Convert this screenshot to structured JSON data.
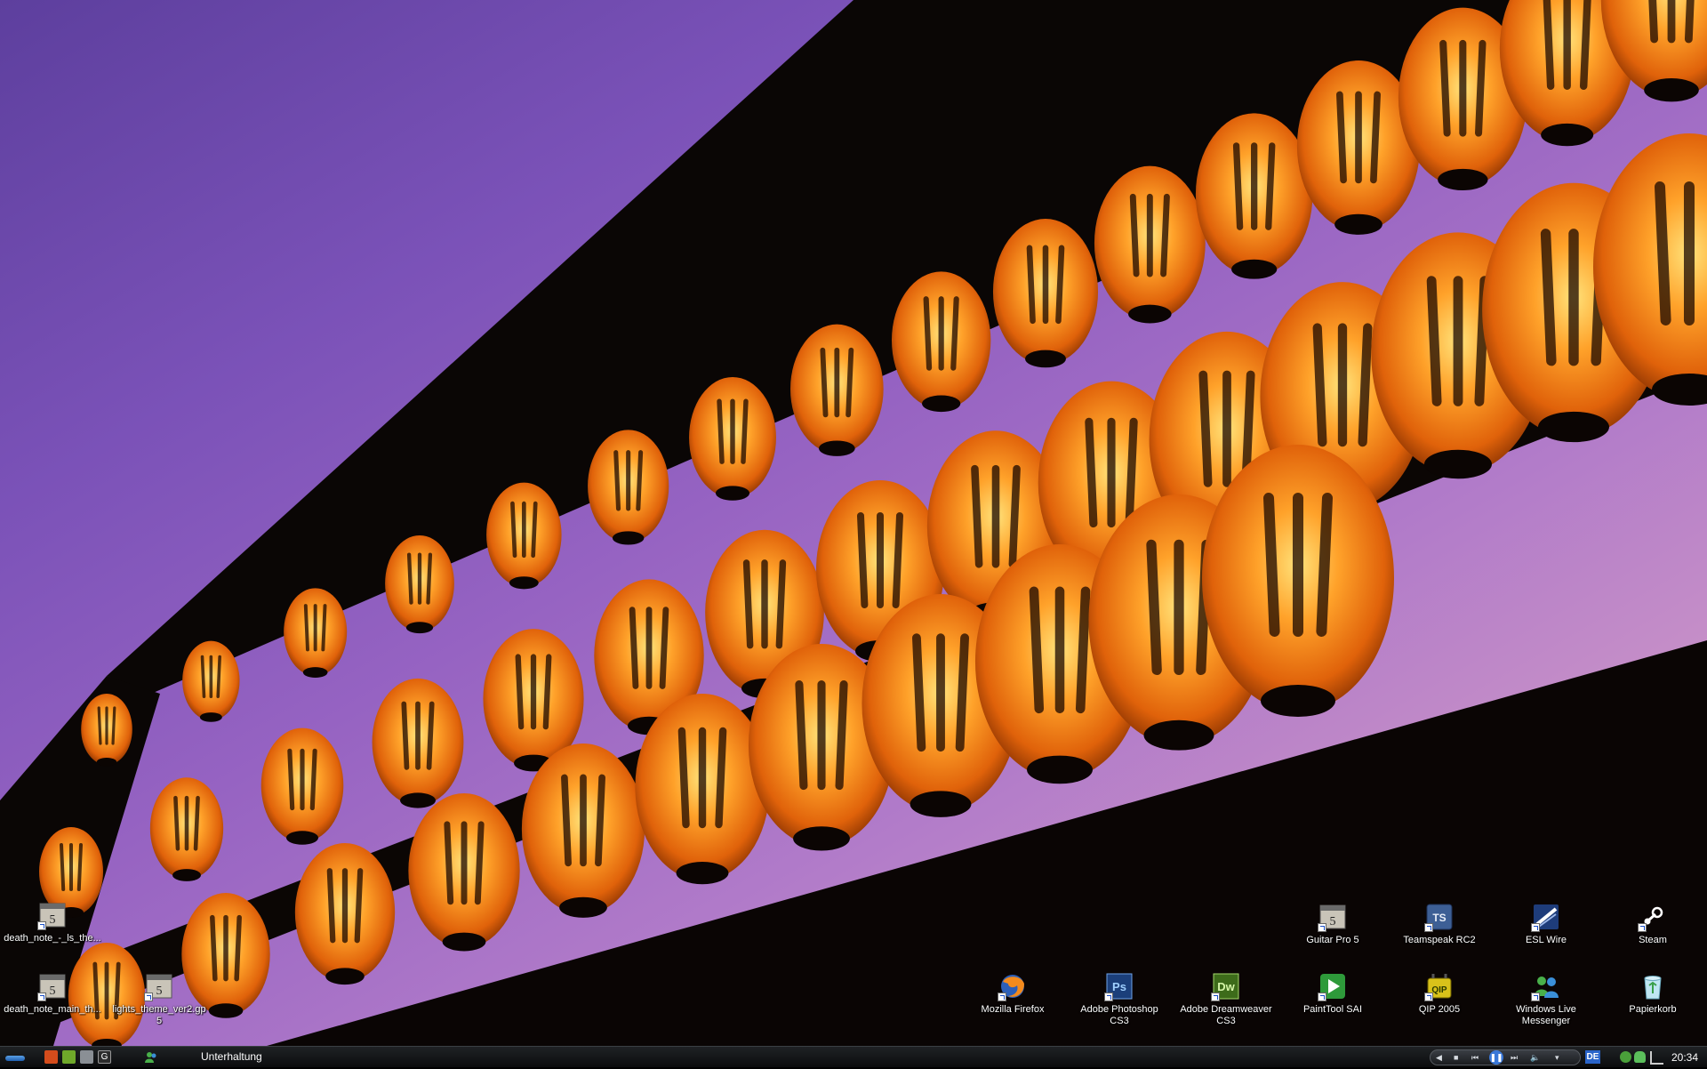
{
  "desktop": {
    "icons_left": [
      {
        "label": "death_note_-_ls_the...",
        "icon": "guitar-pro-file-icon"
      },
      {
        "label": "death_note_main_th...",
        "icon": "guitar-pro-file-icon"
      },
      {
        "label": "lights_theme_ver2.gp5",
        "icon": "guitar-pro-file-icon"
      }
    ],
    "icons_right_top": [
      {
        "label": "Guitar Pro 5",
        "icon": "guitar-pro-icon"
      },
      {
        "label": "Teamspeak RC2",
        "icon": "teamspeak-icon",
        "glyph": "TS"
      },
      {
        "label": "ESL Wire",
        "icon": "esl-wire-icon"
      },
      {
        "label": "Steam",
        "icon": "steam-icon"
      }
    ],
    "icons_right_bottom": [
      {
        "label": "Mozilla Firefox",
        "icon": "firefox-icon"
      },
      {
        "label": "Adobe Photoshop CS3",
        "icon": "photoshop-icon",
        "glyph": "Ps"
      },
      {
        "label": "Adobe Dreamweaver CS3",
        "icon": "dreamweaver-icon",
        "glyph": "Dw"
      },
      {
        "label": "PaintTool SAI",
        "icon": "painttool-sai-icon"
      },
      {
        "label": "QIP 2005",
        "icon": "qip-icon"
      },
      {
        "label": "Windows Live Messenger",
        "icon": "messenger-icon"
      },
      {
        "label": "Papierkorb",
        "icon": "recycle-bin-icon"
      }
    ]
  },
  "taskbar": {
    "active_task": "Unterhaltung",
    "language": "DE",
    "clock": "20:34",
    "colors": {
      "lantern": "#f07a10",
      "sky_top": "#5d3f9e",
      "sky_bottom": "#d7a2c4"
    }
  }
}
